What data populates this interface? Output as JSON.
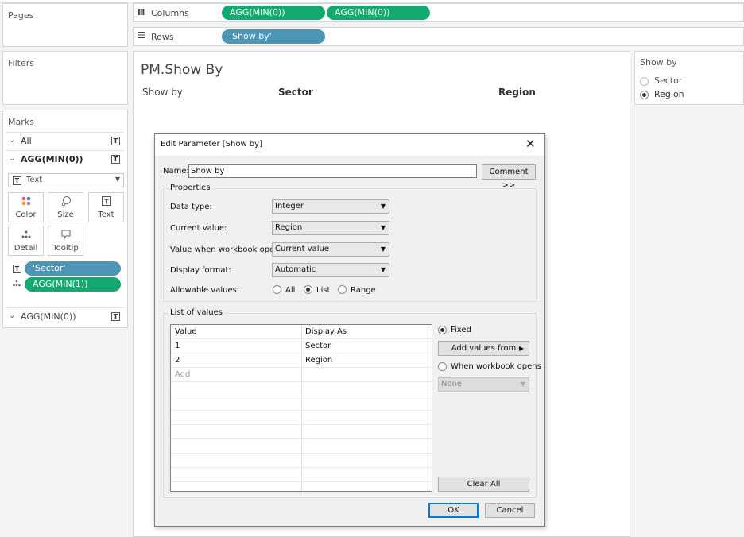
{
  "pages": {
    "title": "Pages"
  },
  "filters": {
    "title": "Filters"
  },
  "columns": {
    "icon": "columns-icon",
    "label": "Columns",
    "pills": [
      "AGG(MIN(0))",
      "AGG(MIN(0))"
    ]
  },
  "rows": {
    "icon": "rows-icon",
    "label": "Rows",
    "pills": [
      "'Show by'"
    ]
  },
  "marks": {
    "title": "Marks",
    "all_label": "All",
    "card1_label": "AGG(MIN(0))",
    "mark_type": "Text",
    "buttons": [
      "Color",
      "Size",
      "Text",
      "Detail",
      "Tooltip"
    ],
    "pill_sector": "'Sector'",
    "pill_agg": "AGG(MIN(1))",
    "card2_label": "AGG(MIN(0))"
  },
  "view": {
    "title": "PM.Show By",
    "header_label": "Show by",
    "col1": "Sector",
    "col2": "Region"
  },
  "show_by_panel": {
    "title": "Show by",
    "options": [
      "Sector",
      "Region"
    ],
    "selected": "Region"
  },
  "dialog": {
    "title": "Edit Parameter [Show by]",
    "name_label": "Name:",
    "name_value": "Show by",
    "comment_button": "Comment >>",
    "properties_title": "Properties",
    "data_type_label": "Data type:",
    "data_type_value": "Integer",
    "current_value_label": "Current value:",
    "current_value_value": "Region",
    "workbook_opens_label": "Value when workbook opens:",
    "workbook_opens_value": "Current value",
    "display_format_label": "Display format:",
    "display_format_value": "Automatic",
    "allowable_label": "Allowable values:",
    "allowable_options": [
      "All",
      "List",
      "Range"
    ],
    "allowable_selected": "List",
    "list_title": "List of values",
    "grid_headers": [
      "Value",
      "Display As"
    ],
    "grid_rows": [
      {
        "value": "1",
        "display": "Sector"
      },
      {
        "value": "2",
        "display": "Region"
      }
    ],
    "grid_add": "Add",
    "fixed_label": "Fixed",
    "add_values_from": "Add values from",
    "when_opens_label": "When workbook opens",
    "none_value": "None",
    "clear_all": "Clear All",
    "ok": "OK",
    "cancel": "Cancel"
  }
}
